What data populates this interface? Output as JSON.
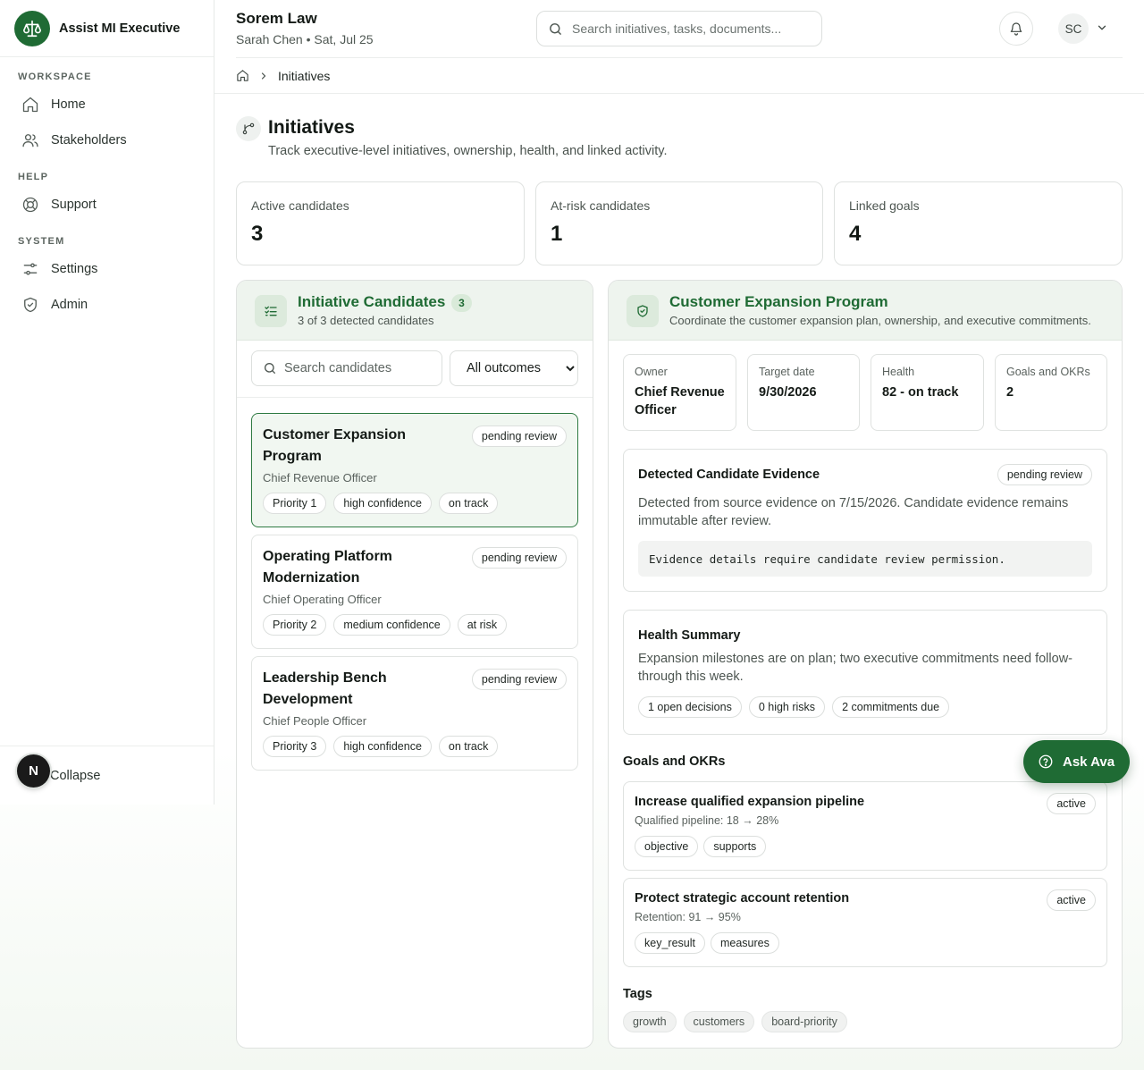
{
  "app": {
    "name": "Assist MI Executive"
  },
  "sidebar": {
    "sections": [
      {
        "heading": "WORKSPACE",
        "items": [
          {
            "label": "Home",
            "icon": "home-icon"
          },
          {
            "label": "Stakeholders",
            "icon": "users-icon"
          }
        ]
      },
      {
        "heading": "HELP",
        "items": [
          {
            "label": "Support",
            "icon": "lifebuoy-icon"
          }
        ]
      },
      {
        "heading": "SYSTEM",
        "items": [
          {
            "label": "Settings",
            "icon": "sliders-icon"
          },
          {
            "label": "Admin",
            "icon": "shield-icon"
          }
        ]
      }
    ],
    "collapse_label": "Collapse",
    "user_badge": "N"
  },
  "header": {
    "org": "Sorem Law",
    "subline": "Sarah Chen • Sat, Jul 25",
    "search_placeholder": "Search initiatives, tasks, documents...",
    "avatar_initials": "SC"
  },
  "breadcrumb": {
    "current": "Initiatives"
  },
  "page": {
    "title": "Initiatives",
    "subtitle": "Track executive-level initiatives, ownership, health, and linked activity."
  },
  "stats": [
    {
      "label": "Active candidates",
      "value": "3"
    },
    {
      "label": "At-risk candidates",
      "value": "1"
    },
    {
      "label": "Linked goals",
      "value": "4"
    }
  ],
  "candidates_panel": {
    "title": "Initiative Candidates",
    "count": "3",
    "subtitle": "3 of 3 detected candidates",
    "search_placeholder": "Search candidates",
    "filter_options": [
      "All outcomes"
    ],
    "filter_selected": "All outcomes",
    "items": [
      {
        "title": "Customer Expansion Program",
        "owner": "Chief Revenue Officer",
        "status": "pending review",
        "priority": "Priority 1",
        "confidence": "high confidence",
        "health": "on track",
        "selected": true
      },
      {
        "title": "Operating Platform Modernization",
        "owner": "Chief Operating Officer",
        "status": "pending review",
        "priority": "Priority 2",
        "confidence": "medium confidence",
        "health": "at risk",
        "selected": false
      },
      {
        "title": "Leadership Bench Development",
        "owner": "Chief People Officer",
        "status": "pending review",
        "priority": "Priority 3",
        "confidence": "high confidence",
        "health": "on track",
        "selected": false
      }
    ]
  },
  "detail": {
    "title": "Customer Expansion Program",
    "subtitle": "Coordinate the customer expansion plan, ownership, and executive commitments.",
    "meta": [
      {
        "label": "Owner",
        "value": "Chief Revenue Officer"
      },
      {
        "label": "Target date",
        "value": "9/30/2026"
      },
      {
        "label": "Health",
        "value": "82 - on track"
      },
      {
        "label": "Goals and OKRs",
        "value": "2"
      }
    ],
    "evidence": {
      "title": "Detected Candidate Evidence",
      "status": "pending review",
      "text": "Detected from source evidence on 7/15/2026. Candidate evidence remains immutable after review.",
      "code": "Evidence details require candidate review permission."
    },
    "health_summary": {
      "title": "Health Summary",
      "text": "Expansion milestones are on plan; two executive commitments need follow-through this week.",
      "chips": [
        "1 open decisions",
        "0 high risks",
        "2 commitments due"
      ]
    },
    "goals_heading": "Goals and OKRs",
    "goals": [
      {
        "title": "Increase qualified expansion pipeline",
        "metric": "Qualified pipeline: 18 → 28%",
        "status": "active",
        "tags": [
          "objective",
          "supports"
        ]
      },
      {
        "title": "Protect strategic account retention",
        "metric": "Retention: 91 → 95%",
        "status": "active",
        "tags": [
          "key_result",
          "measures"
        ]
      }
    ],
    "tags_heading": "Tags",
    "tags": [
      "growth",
      "customers",
      "board-priority"
    ]
  },
  "assistant": {
    "label": "Ask Ava"
  },
  "colors": {
    "brand": "#1f6b34",
    "panel_header": "#eef4ee",
    "selected_card": "#f1f7f1"
  }
}
